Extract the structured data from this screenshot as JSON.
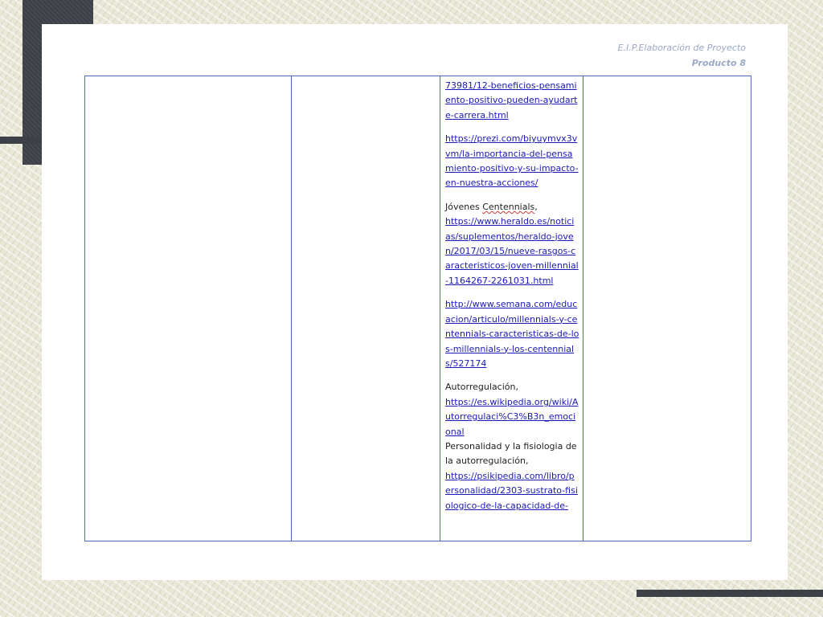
{
  "header": {
    "line1": "E.I.P.Elaboración de Proyecto",
    "line2": "Producto 8"
  },
  "references": [
    {
      "label": "",
      "link": "73981/12-beneficios-pensamiento-positivo-pueden-ayudarte-carrera.html"
    },
    {
      "label": "",
      "link": "https://prezi.com/biyuymvx3vvm/la-importancia-del-pensamiento-positivo-y-su-impacto-en-nuestra-acciones/"
    },
    {
      "label_prefix": "Jóvenes ",
      "label_highlight": "Centennials",
      "label_suffix": ",",
      "link": "https://www.heraldo.es/noticias/suplementos/heraldo-joven/2017/03/15/nueve-rasgos-caracteristicos-joven-millennial-1164267-2261031.html"
    },
    {
      "label": "",
      "link": "http://www.semana.com/educacion/articulo/millennials-y-centennials-caracteristicas-de-los-millennials-y-los-centennials/527174"
    },
    {
      "label": "Autorregulación,",
      "link": "https://es.wikipedia.org/wiki/Autorregulaci%C3%B3n_emocional"
    },
    {
      "label": "Personalidad y la fisiologia de la autorregulación,",
      "link": "https://psikipedia.com/libro/personalidad/2303-sustrato-fisiologico-de-la-capacidad-de-"
    }
  ]
}
